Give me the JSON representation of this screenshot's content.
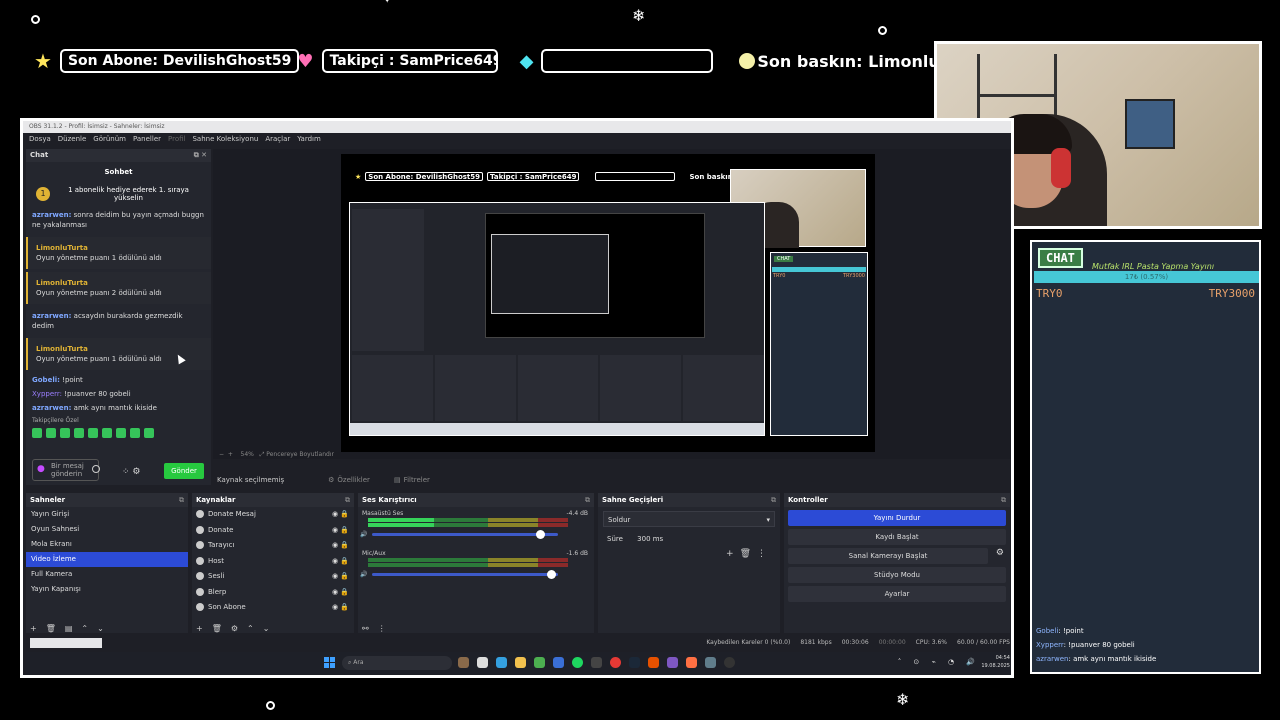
{
  "overlay": {
    "ticker": {
      "last_sub": "Son Abone: DevilishGhost59",
      "follower": "Takipçi : SamPrice649",
      "partial": "So",
      "last_raid": "Son baskın: LimonluTurta"
    },
    "chat_widget": {
      "badge": "CHAT",
      "title": "Mutfak IRL Pasta Yapma Yayını",
      "progress_text": "17₺ (0.57%)",
      "progress_fraction": 0.0057,
      "min_label": "TRY0",
      "max_label": "TRY3000",
      "messages": [
        {
          "user": "Gobeli",
          "text": ": !point"
        },
        {
          "user": "Xypperr",
          "text": ": !puanver 80 gobeli"
        },
        {
          "user": "azrarwen",
          "text": ": amk aynı mantık ikiside"
        }
      ]
    }
  },
  "obs": {
    "title": "OBS 31.1.2 - Profil: İsimsiz - Sahneler: İsimsiz",
    "menu": [
      "Dosya",
      "Düzenle",
      "Görünüm",
      "Paneller",
      "Profil",
      "Sahne Koleksiyonu",
      "Araçlar",
      "Yardım"
    ],
    "chat_dock": {
      "title": "Chat",
      "header": "Sohbet",
      "gift": "1 abonelik hediye ederek 1. sıraya yükselin",
      "messages": [
        {
          "type": "msg",
          "user": "azrarwen:",
          "text": " sonra deidim bu yayın açmadı buggn ne yakalanması"
        },
        {
          "type": "redeem",
          "user": "LimonluTurta",
          "text": "Oyun yönetme puanı 1 ödülünü aldı"
        },
        {
          "type": "redeem",
          "user": "LimonluTurta",
          "text": "Oyun yönetme puanı 2 ödülünü aldı"
        },
        {
          "type": "msg",
          "user": "azrarwen:",
          "text": " acsaydın burakarda gezmezdik dedim"
        },
        {
          "type": "redeem",
          "user": "LimonluTurta",
          "text": "Oyun yönetme puanı 1 ödülünü aldı"
        },
        {
          "type": "msg",
          "user": "Gobeli:",
          "text": " !point"
        },
        {
          "type": "msg",
          "user": "Xypperr:",
          "text": " !puanver 80 gobeli"
        },
        {
          "type": "msg",
          "user": "azrarwen:",
          "text": " amk aynı mantık ikiside"
        }
      ],
      "followers_only": "Takipçilere Özel",
      "input_placeholder": "Bir mesaj gönderin",
      "send": "Gönder"
    },
    "preview": {
      "zoom": "54%",
      "fit": "Pencereye Boyutlandır"
    },
    "context_bar": {
      "no_source": "Kaynak seçilmemiş",
      "properties": "Özellikler",
      "filters": "Filtreler"
    },
    "scenes": {
      "title": "Sahneler",
      "items": [
        "Yayın Girişi",
        "Oyun Sahnesi",
        "Mola Ekranı",
        "Video İzleme",
        "Full Kamera",
        "Yayın Kapanışı"
      ],
      "selected": "Video İzleme"
    },
    "sources": {
      "title": "Kaynaklar",
      "items": [
        "Donate Mesaj",
        "Donate",
        "Tarayıcı",
        "Host",
        "Sesli",
        "Blerp",
        "Son Abone"
      ]
    },
    "mixer": {
      "title": "Ses Karıştırıcı",
      "channels": [
        {
          "name": "Masaüstü Ses",
          "db": "-4.4 dB",
          "level": 0.33,
          "volume": 0.91
        },
        {
          "name": "Mic/Aux",
          "db": "-1.6 dB",
          "level": 0.0,
          "volume": 0.97
        }
      ]
    },
    "transitions": {
      "title": "Sahne Geçişleri",
      "type": "Soldur",
      "duration_label": "Süre",
      "duration": "300 ms"
    },
    "controls": {
      "title": "Kontroller",
      "buttons": [
        "Yayını Durdur",
        "Kaydı Başlat",
        "Sanal Kamerayı Başlat",
        "Stüdyo Modu",
        "Ayarlar"
      ]
    },
    "status": {
      "dropped": "Kaybedilen Kareler 0 (%0.0)",
      "bitrate": "8181 kbps",
      "stream_time": "00:30:06",
      "rec_time": "00:00:00",
      "cpu": "CPU: 3.6%",
      "fps": "60.00 / 60.00 FPS"
    },
    "taskbar": {
      "search": "Ara",
      "time": "04:54",
      "date": "19.08.2025"
    }
  },
  "colors": {
    "accent": "#2c4bd6",
    "send": "#27c93f",
    "chat_title": "#b8e26b",
    "progress": "#46c7d6"
  }
}
